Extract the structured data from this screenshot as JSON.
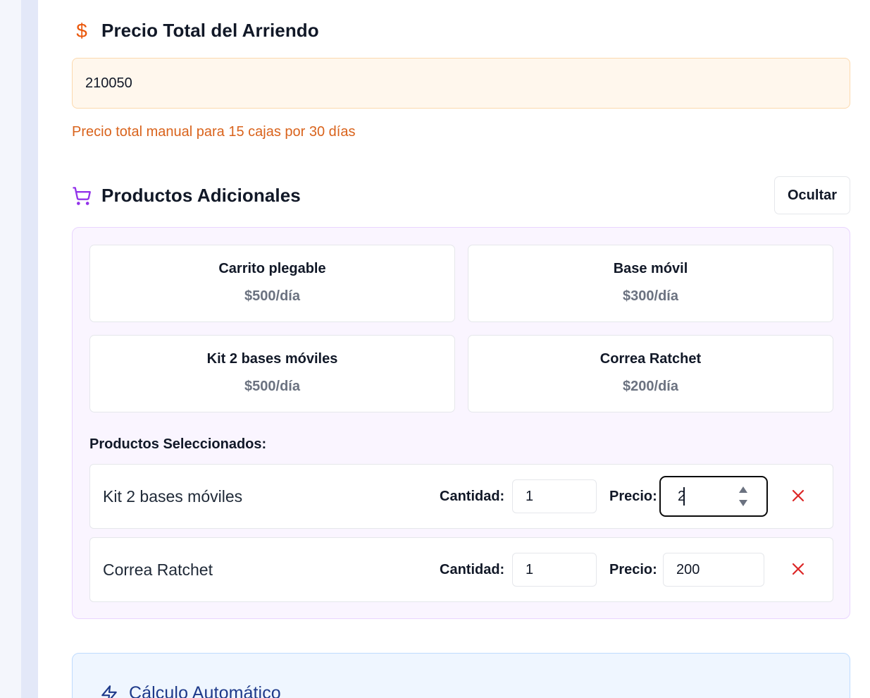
{
  "total_price": {
    "title": "Precio Total del Arriendo",
    "icon": "dollar-icon",
    "value": "210050",
    "note": "Precio total manual para 15 cajas por 30 días"
  },
  "additional_products": {
    "title": "Productos Adicionales",
    "icon": "cart-icon",
    "toggle_label": "Ocultar",
    "catalog": [
      {
        "name": "Carrito plegable",
        "price": "$500/día"
      },
      {
        "name": "Base móvil",
        "price": "$300/día"
      },
      {
        "name": "Kit 2 bases móviles",
        "price": "$500/día"
      },
      {
        "name": "Correa Ratchet",
        "price": "$200/día"
      }
    ],
    "selected_title": "Productos Seleccionados:",
    "selected": [
      {
        "name": "Kit 2 bases móviles",
        "quantity_label": "Cantidad:",
        "quantity": "1",
        "price_label": "Precio:",
        "price": "2"
      },
      {
        "name": "Correa Ratchet",
        "quantity_label": "Cantidad:",
        "quantity": "1",
        "price_label": "Precio:",
        "price": "200"
      }
    ]
  },
  "auto_calc": {
    "title": "Cálculo Automático",
    "icon": "lightning-icon"
  },
  "colors": {
    "accent_orange": "#ea580c",
    "accent_purple": "#9333ea",
    "remove_red": "#dc2626",
    "accent_blue": "#1e3a8a"
  }
}
